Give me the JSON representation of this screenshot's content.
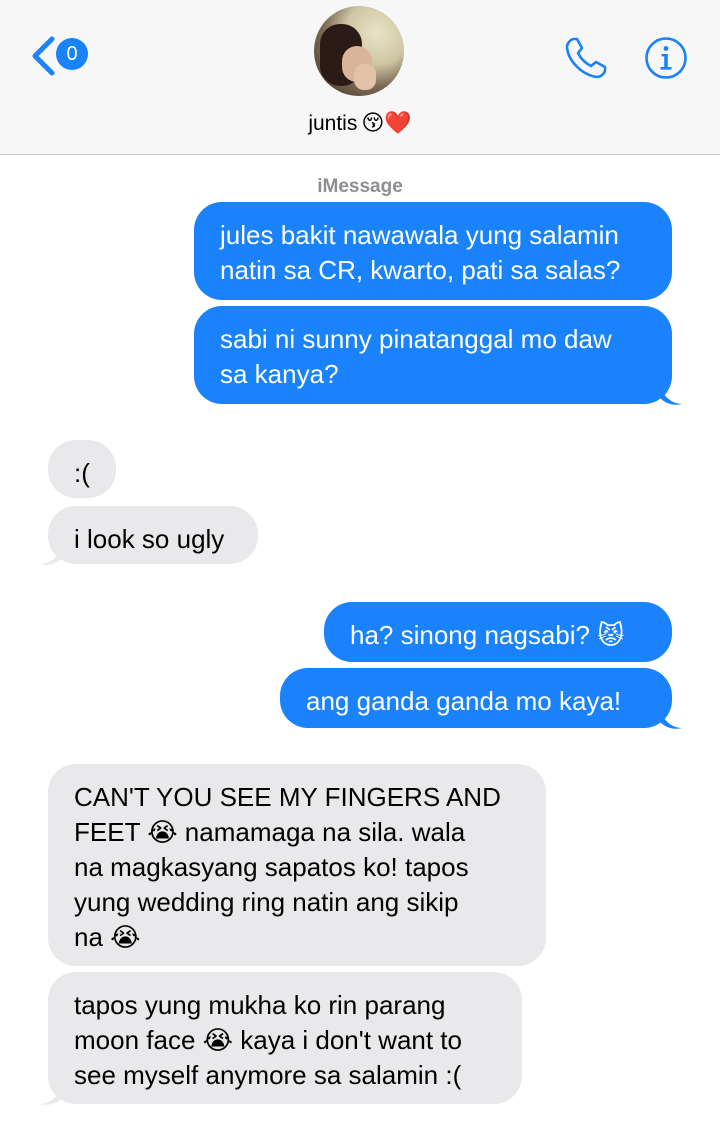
{
  "header": {
    "back_badge": "0",
    "contact_name": "juntis",
    "contact_emoji": "😚❤️",
    "icons": [
      "chevron-left-icon",
      "phone-icon",
      "info-icon"
    ]
  },
  "service_label": "iMessage",
  "colors": {
    "sent": "#1a82fb",
    "received": "#e9e9eb",
    "accent": "#1a82fb"
  },
  "messages": [
    {
      "from": "me",
      "text": "jules bakit nawawala yung salamin\nnatin sa CR, kwarto, pati sa salas?"
    },
    {
      "from": "me",
      "text": "sabi ni sunny pinatanggal mo daw\nsa kanya?"
    },
    {
      "from": "them",
      "text": ":("
    },
    {
      "from": "them",
      "text": "i look so ugly"
    },
    {
      "from": "me",
      "text": "ha? sinong nagsabi? 😾"
    },
    {
      "from": "me",
      "text": "ang ganda ganda mo kaya!"
    },
    {
      "from": "them",
      "text": "CAN'T YOU SEE MY FINGERS AND\nFEET 😭 namamaga na sila. wala\nna magkasyang sapatos ko! tapos\nyung wedding ring natin ang sikip\nna 😭"
    },
    {
      "from": "them",
      "text": "tapos yung mukha ko rin parang\nmoon face 😭 kaya i don't want to\nsee myself anymore sa salamin :("
    }
  ]
}
